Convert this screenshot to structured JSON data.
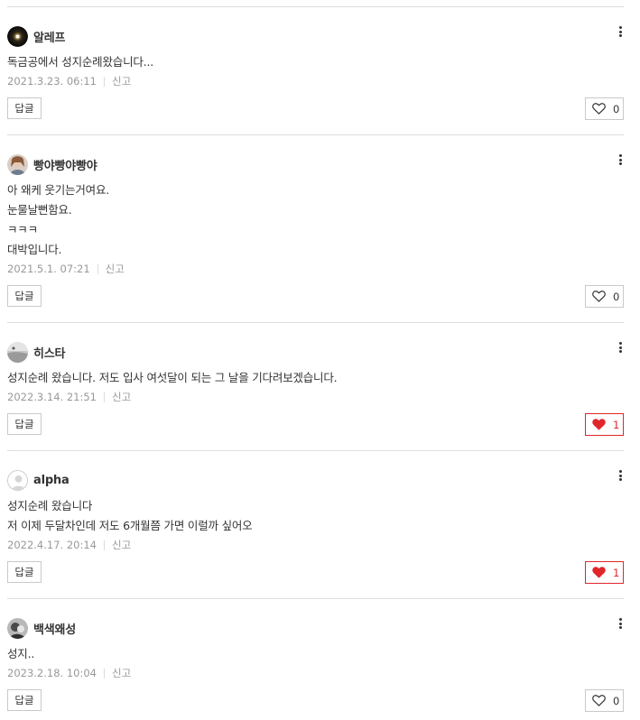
{
  "comments": [
    {
      "username": "알레프",
      "avatar_icon": "galaxy-avatar-icon",
      "lines": [
        "독금공에서 성지순례왔습니다..."
      ],
      "timestamp": "2021.3.23. 06:11",
      "report_label": "신고",
      "reply_label": "답글",
      "like_count": "0",
      "liked": false
    },
    {
      "username": "빵야빵야빵야",
      "avatar_icon": "person-photo-avatar-icon",
      "lines": [
        "아 왜케 웃기는거여요.",
        "눈물날뻔함요.",
        "ㅋㅋㅋ",
        "대박입니다."
      ],
      "timestamp": "2021.5.1. 07:21",
      "report_label": "신고",
      "reply_label": "답글",
      "like_count": "0",
      "liked": false
    },
    {
      "username": "히스타",
      "avatar_icon": "landscape-avatar-icon",
      "lines": [
        "성지순례 왔습니다. 저도 입사 여섯달이 되는 그 날을 기다려보겠습니다."
      ],
      "timestamp": "2022.3.14. 21:51",
      "report_label": "신고",
      "reply_label": "답글",
      "like_count": "1",
      "liked": true
    },
    {
      "username": "alpha",
      "avatar_icon": "default-user-avatar-icon",
      "lines": [
        "성지순례 왔습니다",
        "저 이제 두달차인데 저도 6개월쯤 가면 이럴까 싶어오"
      ],
      "timestamp": "2022.4.17. 20:14",
      "report_label": "신고",
      "reply_label": "답글",
      "like_count": "1",
      "liked": true
    },
    {
      "username": "백색왜성",
      "avatar_icon": "sketch-avatar-icon",
      "lines": [
        "성지.."
      ],
      "timestamp": "2023.2.18. 10:04",
      "report_label": "신고",
      "reply_label": "답글",
      "like_count": "0",
      "liked": false
    }
  ],
  "colors": {
    "divider": "#dddddd",
    "text": "#333333",
    "meta": "#999999",
    "like_active": "#e0262b"
  }
}
